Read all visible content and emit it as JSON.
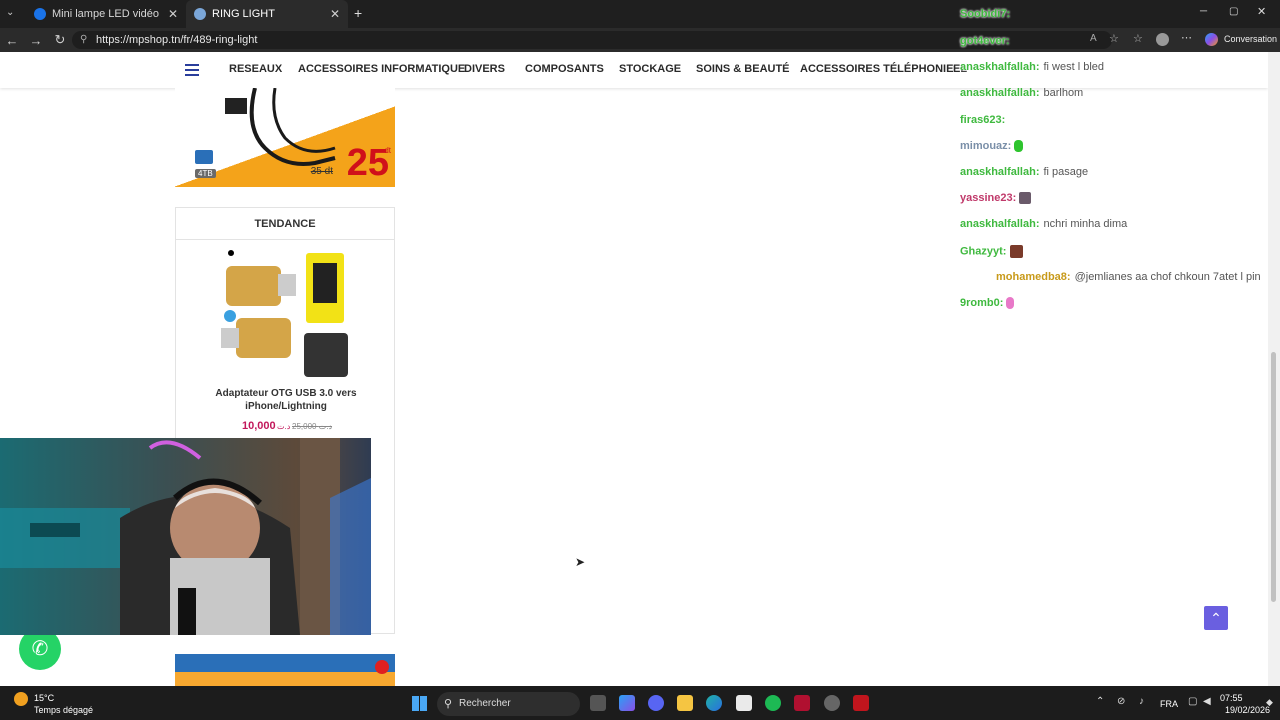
{
  "browser": {
    "tabs": [
      {
        "title": "Mini lampe LED vidéo polyvalente",
        "close": "✕"
      },
      {
        "title": "RING LIGHT",
        "close": "✕"
      }
    ],
    "new_tab": "+",
    "url": "https://mpshop.tn/fr/489-ring-light",
    "conversation_label": "Conversation"
  },
  "menu": {
    "items": [
      "RESEAUX",
      "ACCESSOIRES INFORMATIQUE",
      "DIVERS",
      "COMPOSANTS",
      "STOCKAGE",
      "SOINS & BEAUTÉ",
      "ACCESSOIRES TÉLÉPHONIE",
      "EL"
    ]
  },
  "banner1": {
    "price": "25",
    "currency": "dt",
    "old_price": "35 dt",
    "capacity": "4TB"
  },
  "trend": {
    "heading": "TENDANCE",
    "product_name": "Adaptateur OTG USB 3.0 vers iPhone/Lightning",
    "price": "10,000",
    "currency": "د.ت",
    "old_price": "25,000 د.ت"
  },
  "chat": [
    {
      "user": "Soobidi7:",
      "msg": "",
      "color": "#3fb93f"
    },
    {
      "user": "got4ever:",
      "msg": "",
      "color": "#3fb93f"
    },
    {
      "user": "anaskhalfallah:",
      "msg": "fi west l bled",
      "color": "#3fb93f"
    },
    {
      "user": "anaskhalfallah:",
      "msg": "barlhom",
      "color": "#3fb93f"
    },
    {
      "user": "firas623:",
      "msg": "",
      "color": "#3fb93f"
    },
    {
      "user": "mimouaz:",
      "msg": "",
      "color": "#7a8fa8"
    },
    {
      "user": "anaskhalfallah:",
      "msg": "fi pasage",
      "color": "#3fb93f"
    },
    {
      "user": "yassine23:",
      "msg": "",
      "color": "#c0396a"
    },
    {
      "user": "anaskhalfallah:",
      "msg": "nchri minha dima",
      "color": "#3fb93f"
    },
    {
      "user": "Ghazyyt:",
      "msg": "",
      "color": "#3fb93f"
    },
    {
      "user": "mohamedba8:",
      "msg": "@jemlianes aa chof chkoun 7atet l pin",
      "color": "#c89a1a"
    },
    {
      "user": "9romb0:",
      "msg": "",
      "color": "#3fb93f"
    }
  ],
  "taskbar": {
    "temperature": "15°C",
    "weather": "Temps dégagé",
    "search_placeholder": "Rechercher",
    "language": "FRA",
    "time": "07:55",
    "date": "19/02/2026"
  },
  "icons": [
    "back-icon",
    "forward-icon",
    "reload-icon",
    "search-icon",
    "whatsapp-icon",
    "arrow-up-icon",
    "windows-icon",
    "wifi-icon",
    "volume-icon",
    "battery-icon"
  ]
}
